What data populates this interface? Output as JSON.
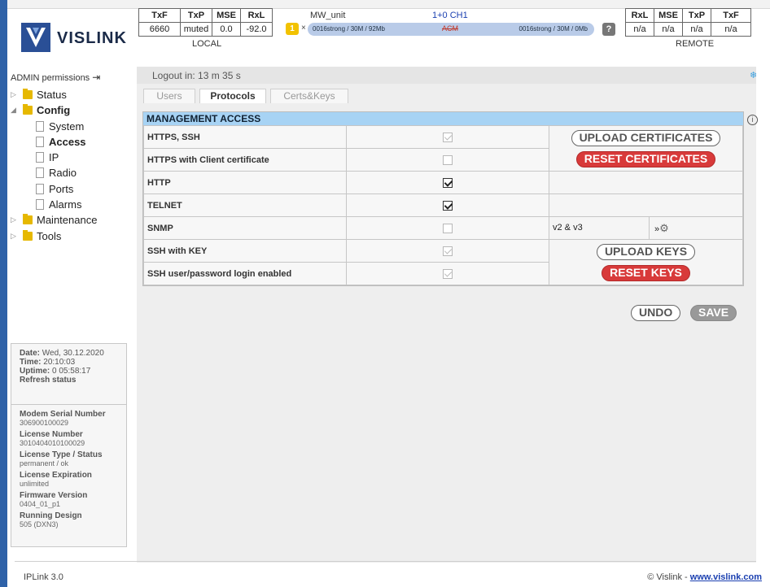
{
  "brand": {
    "name": "VISLINK"
  },
  "local": {
    "headers": [
      "TxF",
      "TxP",
      "MSE",
      "RxL"
    ],
    "values": [
      "6660",
      "muted",
      "0.0",
      "-92.0"
    ],
    "label": "LOCAL"
  },
  "remote": {
    "headers": [
      "RxL",
      "MSE",
      "TxP",
      "TxF"
    ],
    "values": [
      "n/a",
      "n/a",
      "n/a",
      "n/a"
    ],
    "label": "REMOTE"
  },
  "link": {
    "unit": "MW_unit",
    "channel": "1+0 CH1",
    "badge": "1",
    "x": "×",
    "left_text": "0016strong / 30M / 92Mb",
    "center_text": "ACM",
    "right_text": "0016strong / 30M / 0Mb",
    "help": "?"
  },
  "sidebar": {
    "admin": "ADMIN permissions",
    "tree": [
      {
        "label": "Status",
        "type": "folder",
        "arrow": "▷",
        "bold": false
      },
      {
        "label": "Config",
        "type": "folder",
        "arrow": "◢",
        "bold": true
      },
      {
        "label": "System",
        "type": "doc",
        "bold": false
      },
      {
        "label": "Access",
        "type": "doc",
        "bold": true
      },
      {
        "label": "IP",
        "type": "doc",
        "bold": false
      },
      {
        "label": "Radio",
        "type": "doc",
        "bold": false
      },
      {
        "label": "Ports",
        "type": "doc",
        "bold": false
      },
      {
        "label": "Alarms",
        "type": "doc",
        "bold": false
      },
      {
        "label": "Maintenance",
        "type": "folder",
        "arrow": "▷",
        "bold": false
      },
      {
        "label": "Tools",
        "type": "folder",
        "arrow": "▷",
        "bold": false
      }
    ],
    "status_box": {
      "date_label": "Date:",
      "date": "Wed, 30.12.2020",
      "time_label": "Time:",
      "time": "20:10:03",
      "uptime_label": "Uptime:",
      "uptime": "0 05:58:17",
      "refresh": "Refresh status"
    },
    "device_box": [
      {
        "k": "Modem Serial Number",
        "v": "306900100029"
      },
      {
        "k": "License Number",
        "v": "3010404010100029"
      },
      {
        "k": "License Type / Status",
        "v": "permanent / ok"
      },
      {
        "k": "License Expiration",
        "v": "unlimited"
      },
      {
        "k": "Firmware Version",
        "v": "0404_01_p1"
      },
      {
        "k": "Running Design",
        "v": "505 (DXN3)"
      }
    ]
  },
  "main": {
    "logout": "Logout in: 13 m 35 s",
    "tabs": [
      "Users",
      "Protocols",
      "Certs&Keys"
    ],
    "section": "MANAGEMENT ACCESS",
    "rows": [
      {
        "name": "HTTPS, SSH",
        "state": "disabled"
      },
      {
        "name": "HTTPS with Client certificate",
        "state": "empty"
      },
      {
        "name": "HTTP",
        "state": "checked"
      },
      {
        "name": "TELNET",
        "state": "checked"
      },
      {
        "name": "SNMP",
        "state": "empty"
      },
      {
        "name": "SSH with KEY",
        "state": "disabled"
      },
      {
        "name": "SSH user/password login enabled",
        "state": "disabled"
      }
    ],
    "upload_cert": "UPLOAD CERTIFICATES",
    "reset_cert": "RESET CERTIFICATES",
    "snmp_version": "v2 & v3",
    "snmp_arrow": "»",
    "upload_keys": "UPLOAD KEYS",
    "reset_keys": "RESET KEYS",
    "undo": "UNDO",
    "save": "SAVE"
  },
  "footer": {
    "left": "IPLink 3.0",
    "right_prefix": "© Vislink - ",
    "right_link": "www.vislink.com"
  }
}
